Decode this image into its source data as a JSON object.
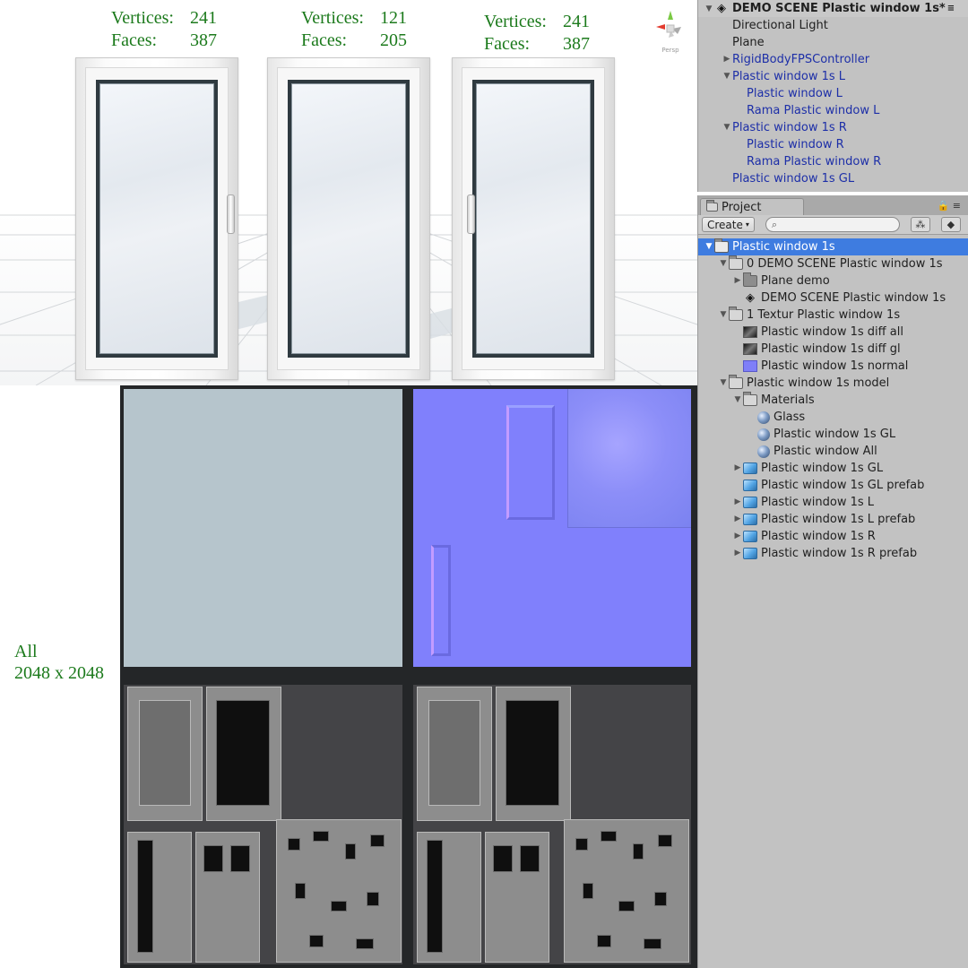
{
  "viewport": {
    "models": [
      {
        "vertices_label": "Vertices:",
        "vertices": "241",
        "faces_label": "Faces:",
        "faces": "387"
      },
      {
        "vertices_label": "Vertices:",
        "vertices": "121",
        "faces_label": "Faces:",
        "faces": "205"
      },
      {
        "vertices_label": "Vertices:",
        "vertices": "241",
        "faces_label": "Faces:",
        "faces": "387"
      }
    ],
    "gizmo_label": "Persp"
  },
  "atlas": {
    "label_line1": "All",
    "label_line2": "2048 x 2048"
  },
  "hierarchy": {
    "scene_title": "DEMO SCENE Plastic window 1s*",
    "items": [
      {
        "label": "Directional Light"
      },
      {
        "label": "Plane"
      },
      {
        "label": "RigidBodyFPSController"
      },
      {
        "label": "Plastic window 1s L"
      },
      {
        "label": "Plastic window L"
      },
      {
        "label": "Rama Plastic window L"
      },
      {
        "label": "Plastic window 1s R"
      },
      {
        "label": "Plastic window R"
      },
      {
        "label": "Rama Plastic window R"
      },
      {
        "label": "Plastic window 1s GL"
      }
    ]
  },
  "project": {
    "tab_label": "Project",
    "create_label": "Create",
    "search_placeholder": "",
    "items": [
      {
        "label": "Plastic window 1s"
      },
      {
        "label": "0 DEMO SCENE Plastic window 1s"
      },
      {
        "label": "Plane demo"
      },
      {
        "label": "DEMO SCENE Plastic window 1s"
      },
      {
        "label": "1 Textur Plastic window 1s"
      },
      {
        "label": "Plastic window 1s diff all"
      },
      {
        "label": "Plastic window 1s diff gl"
      },
      {
        "label": "Plastic window 1s normal"
      },
      {
        "label": "Plastic window 1s model"
      },
      {
        "label": "Materials"
      },
      {
        "label": "Glass"
      },
      {
        "label": "Plastic window 1s GL"
      },
      {
        "label": "Plastic window All"
      },
      {
        "label": "Plastic window 1s GL"
      },
      {
        "label": "Plastic window 1s GL prefab"
      },
      {
        "label": "Plastic window 1s L"
      },
      {
        "label": "Plastic window 1s L prefab"
      },
      {
        "label": "Plastic window 1s R"
      },
      {
        "label": "Plastic window 1s R prefab"
      }
    ]
  },
  "colors": {
    "stats_text": "#1c7a1c",
    "selection": "#3e7ce0",
    "prefab_text": "#1d2fa8",
    "panel_bg": "#c2c2c2"
  }
}
